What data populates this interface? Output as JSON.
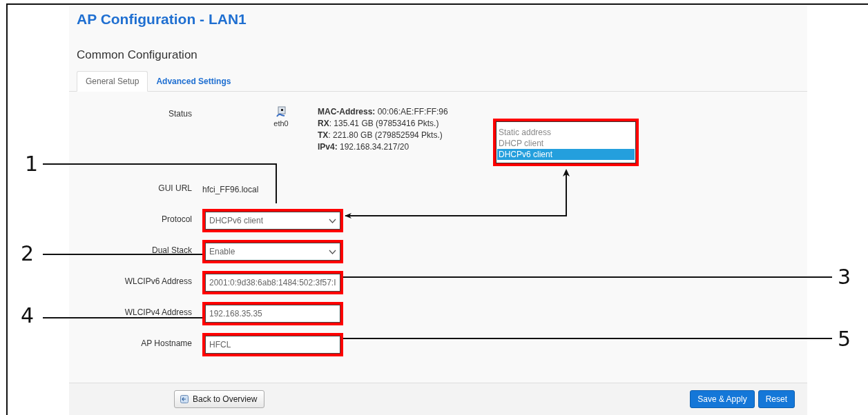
{
  "page_title": "AP Configuration - LAN1",
  "section_title": "Common Configuration",
  "tabs": [
    {
      "label": "General Setup",
      "selected": true
    },
    {
      "label": "Advanced Settings",
      "selected": false
    }
  ],
  "status": {
    "label": "Status",
    "interface": "eth0",
    "lines": [
      "**MAC-Address:** 00:06:AE:FF:FF:96",
      "**RX**: 135.41 GB (97853416 Pkts.)",
      "**TX**: 221.80 GB (279852594 Pkts.)",
      "**IPv4:** 192.168.34.217/20"
    ]
  },
  "protocol_dropdown": {
    "options": [
      {
        "label": "Static address",
        "selected": false
      },
      {
        "label": "DHCP client",
        "selected": false
      },
      {
        "label": "DHCPv6 client",
        "selected": true
      }
    ]
  },
  "fields": [
    {
      "label": "GUI URL",
      "kind": "text",
      "value": "hfci_FF96.local"
    },
    {
      "label": "Protocol",
      "kind": "select",
      "value": "DHCPv6 client"
    },
    {
      "label": "Dual Stack",
      "kind": "select",
      "value": "Enable"
    },
    {
      "label": "WLCIPv6 Address",
      "kind": "input",
      "value": "2001:0:9d38:6ab8:1484:502:3f57:I"
    },
    {
      "label": "WLCIPv4 Address",
      "kind": "input",
      "value": "192.168.35.35"
    },
    {
      "label": "AP Hostname",
      "kind": "input",
      "value": "HFCL"
    }
  ],
  "callouts": [
    "1",
    "2",
    "3",
    "4",
    "5"
  ],
  "footer": {
    "back": "Back to Overview",
    "save": "Save & Apply",
    "reset": "Reset"
  }
}
